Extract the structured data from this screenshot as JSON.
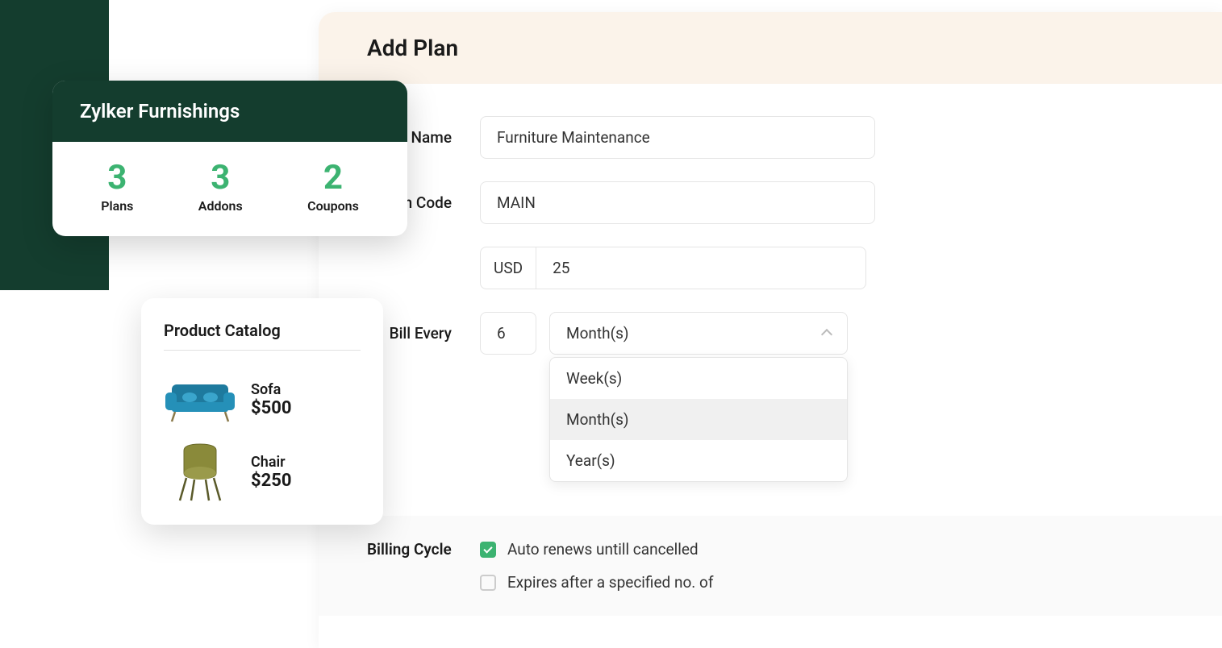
{
  "summary": {
    "title": "Zylker Furnishings",
    "stats": [
      {
        "number": "3",
        "label": "Plans"
      },
      {
        "number": "3",
        "label": "Addons"
      },
      {
        "number": "2",
        "label": "Coupons"
      }
    ]
  },
  "catalog": {
    "title": "Product Catalog",
    "items": [
      {
        "name": "Sofa",
        "price": "$500"
      },
      {
        "name": "Chair",
        "price": "$250"
      }
    ]
  },
  "form": {
    "title": "Add Plan",
    "plan_name_label": "n Name",
    "plan_name_value": "Furniture Maintenance",
    "plan_code_label": "n Code",
    "plan_code_value": "MAIN",
    "currency": "USD",
    "price_value": "25",
    "bill_every_label": "Bill Every",
    "bill_every_value": "6",
    "period_selected": "Month(s)",
    "period_options": [
      "Week(s)",
      "Month(s)",
      "Year(s)"
    ],
    "billing_cycle_label": "Billing Cycle",
    "auto_renew_label": "Auto renews untill cancelled",
    "expires_label": "Expires after a specified no. of"
  }
}
